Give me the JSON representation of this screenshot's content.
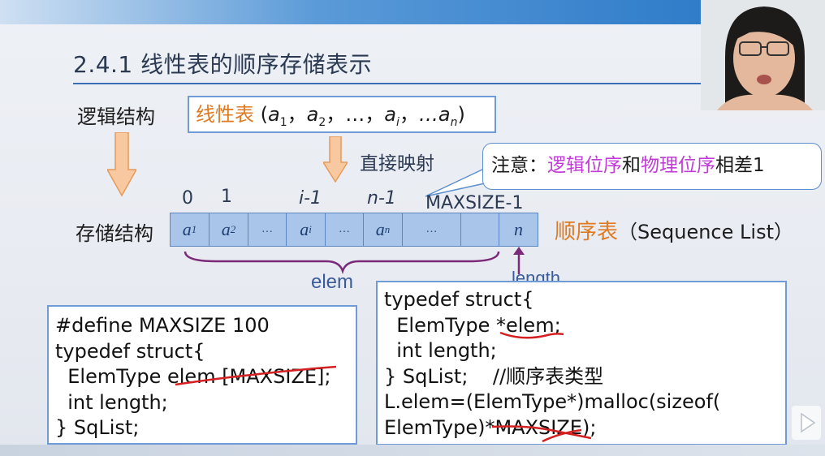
{
  "slide": {
    "title": "2.4.1 线性表的顺序存储表示"
  },
  "logical": {
    "label": "逻辑结构",
    "box_name": "线性表",
    "box_open": " (",
    "a1": "a",
    "a1_sub": "1",
    "a2": "a",
    "a2_sub": "2",
    "ellipsis": "…",
    "ai": "a",
    "ai_sub": "i",
    "an_prefix": "…a",
    "an_sub": "n",
    "box_close": ")",
    "sep": "，"
  },
  "mapping": {
    "label": "直接映射"
  },
  "callout": {
    "prefix": "注意：",
    "logical_order": "逻辑位序",
    "and": "和",
    "physical_order": "物理位序",
    "suffix": "相差1"
  },
  "storage": {
    "label": "存储结构",
    "indices": [
      "0",
      "1",
      "i-1",
      "n-1",
      "MAXSIZE-1"
    ],
    "cells": [
      "a1",
      "a2",
      "...",
      "ai",
      "...",
      "an",
      "...",
      "",
      "n"
    ],
    "seq_cn": "顺序表",
    "seq_en": "（Sequence List）",
    "elem_label": "elem",
    "length_label": "length"
  },
  "code_left": {
    "lines": [
      "#define MAXSIZE 100",
      "typedef struct{",
      "  ElemType elem [MAXSIZE];",
      "  int length;",
      "} SqList;"
    ]
  },
  "code_right": {
    "lines": [
      "typedef struct{",
      "  ElemType *elem;",
      "  int length;",
      "} SqList;    //顺序表类型",
      "L.elem=(ElemType*)malloc(sizeof(",
      "ElemType)*MAXSIZE);"
    ]
  },
  "colors": {
    "orange": "#e07a21",
    "magenta": "#c23ad8",
    "cell_fill": "#a9c6ea",
    "box_border": "#6f9bd6",
    "brace": "#7a2a78",
    "annotation_red": "#d42020"
  }
}
